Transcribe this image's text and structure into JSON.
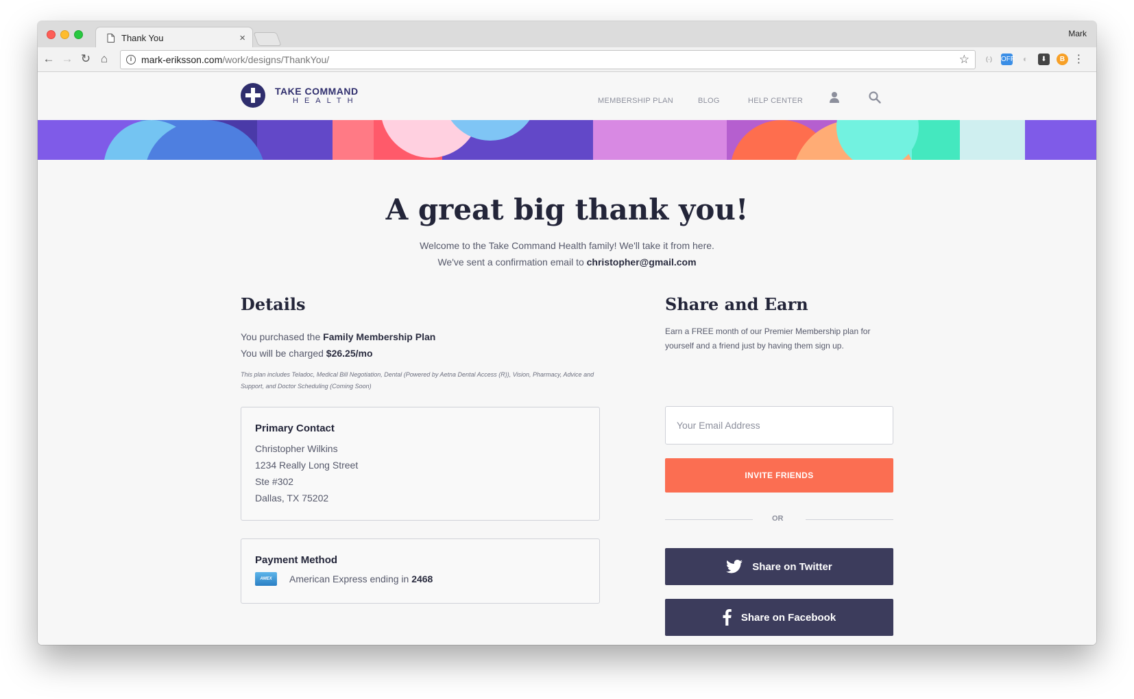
{
  "browser": {
    "tab_title": "Thank You",
    "profile_name": "Mark",
    "url_host": "mark-eriksson.com",
    "url_path": "/work/designs/ThankYou/"
  },
  "site": {
    "logo_top": "TAKE COMMAND",
    "logo_bottom": "HEALTH",
    "nav": [
      "MEMBERSHIP PLAN",
      "BLOG",
      "HELP CENTER"
    ]
  },
  "hero": {
    "title": "A great big thank you!",
    "welcome": "Welcome to the Take Command Health family! We'll take it from here.",
    "confirm_prefix": "We've sent a confirmation email to ",
    "email": "christopher@gmail.com"
  },
  "details": {
    "heading": "Details",
    "purchased_prefix": "You purchased the ",
    "plan": "Family Membership Plan",
    "charged_prefix": "You will be charged ",
    "price": "$26.25/mo",
    "fineprint": "This plan includes Teladoc, Medical Bill Negotiation, Dental (Powered by Aetna Dental Access (R)), Vision, Pharmacy, Advice and Support, and Doctor Scheduling (Coming Soon)",
    "contact": {
      "title": "Primary Contact",
      "lines": [
        "Christopher Wilkins",
        "1234 Really Long Street",
        "Ste #302",
        "Dallas, TX 75202"
      ]
    },
    "payment": {
      "title": "Payment Method",
      "card_logo_text": "AMEX",
      "prefix": "American Express ending in ",
      "last4": "2468"
    }
  },
  "share": {
    "heading": "Share and Earn",
    "description": "Earn a FREE month of our Premier Membership plan for yourself and a friend just by having them sign up.",
    "email_placeholder": "Your Email Address",
    "invite_label": "INVITE FRIENDS",
    "or_label": "OR",
    "twitter_label": "Share on Twitter",
    "facebook_label": "Share on Facebook"
  },
  "colors": {
    "accent": "#fb6e52",
    "navy": "#2f2e6d",
    "social": "#3c3c5c",
    "text": "#232539"
  }
}
